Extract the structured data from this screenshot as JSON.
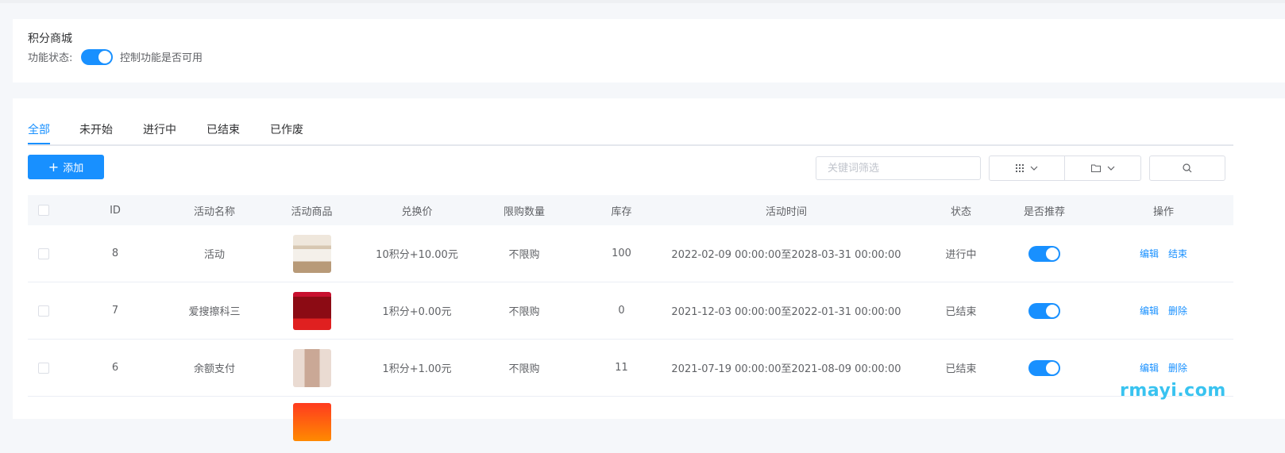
{
  "feature": {
    "title": "积分商城",
    "status_label": "功能状态:",
    "enabled": true,
    "description": "控制功能是否可用"
  },
  "tabs": [
    "全部",
    "未开始",
    "进行中",
    "已结束",
    "已作废"
  ],
  "active_tab": "全部",
  "toolbar": {
    "add_label": "添加",
    "search_placeholder": "关键词筛选",
    "grid_icon": "grid-icon",
    "folder_icon": "folder-icon",
    "search_icon": "search-icon"
  },
  "table": {
    "columns": [
      "ID",
      "活动名称",
      "活动商品",
      "兑换价",
      "限购数量",
      "库存",
      "活动时间",
      "状态",
      "是否推荐",
      "操作"
    ],
    "rows": [
      {
        "id": "8",
        "name": "活动",
        "price": "10积分+10.00元",
        "limit": "不限购",
        "stock": "100",
        "time": "2022-02-09 00:00:00至2028-03-31 00:00:00",
        "status": "进行中",
        "recommended": true,
        "actions": [
          "编辑",
          "结束"
        ]
      },
      {
        "id": "7",
        "name": "爱搜擦科三",
        "price": "1积分+0.00元",
        "limit": "不限购",
        "stock": "0",
        "time": "2021-12-03 00:00:00至2022-01-31 00:00:00",
        "status": "已结束",
        "recommended": true,
        "actions": [
          "编辑",
          "删除"
        ]
      },
      {
        "id": "6",
        "name": "余额支付",
        "price": "1积分+1.00元",
        "limit": "不限购",
        "stock": "11",
        "time": "2021-07-19 00:00:00至2021-08-09 00:00:00",
        "status": "已结束",
        "recommended": true,
        "actions": [
          "编辑",
          "删除"
        ]
      }
    ]
  },
  "colors": {
    "primary": "#1890ff",
    "watermark": "#39c3f0"
  },
  "watermark": "rmayi.com"
}
